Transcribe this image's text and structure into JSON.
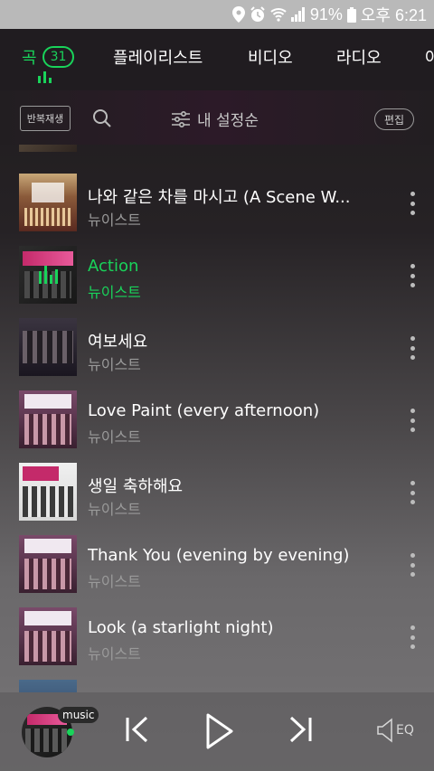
{
  "status_bar": {
    "battery": "91%",
    "time": "오후 6:21"
  },
  "tabs": [
    {
      "label": "곡",
      "badge": "31",
      "active": true
    },
    {
      "label": "플레이리스트"
    },
    {
      "label": "비디오"
    },
    {
      "label": "라디오"
    },
    {
      "label": "아"
    }
  ],
  "toolbar": {
    "repeat_label": "반복재생",
    "sort_label": "내 설정순",
    "edit_label": "편집"
  },
  "songs": [
    {
      "title": "나와 같은 차를 마시고 (A Scene W...",
      "artist": "뉴이스트"
    },
    {
      "title": "Action",
      "artist": "뉴이스트",
      "playing": true
    },
    {
      "title": "여보세요",
      "artist": "뉴이스트"
    },
    {
      "title": "Love Paint (every afternoon)",
      "artist": "뉴이스트"
    },
    {
      "title": "생일 축하해요",
      "artist": "뉴이스트"
    },
    {
      "title": "Thank You (evening by evening)",
      "artist": "뉴이스트"
    },
    {
      "title": "Look (a starlight night)",
      "artist": "뉴이스트"
    }
  ],
  "player": {
    "source_tag": "music",
    "eq_label": "EQ"
  },
  "colors": {
    "accent": "#19d35a"
  }
}
